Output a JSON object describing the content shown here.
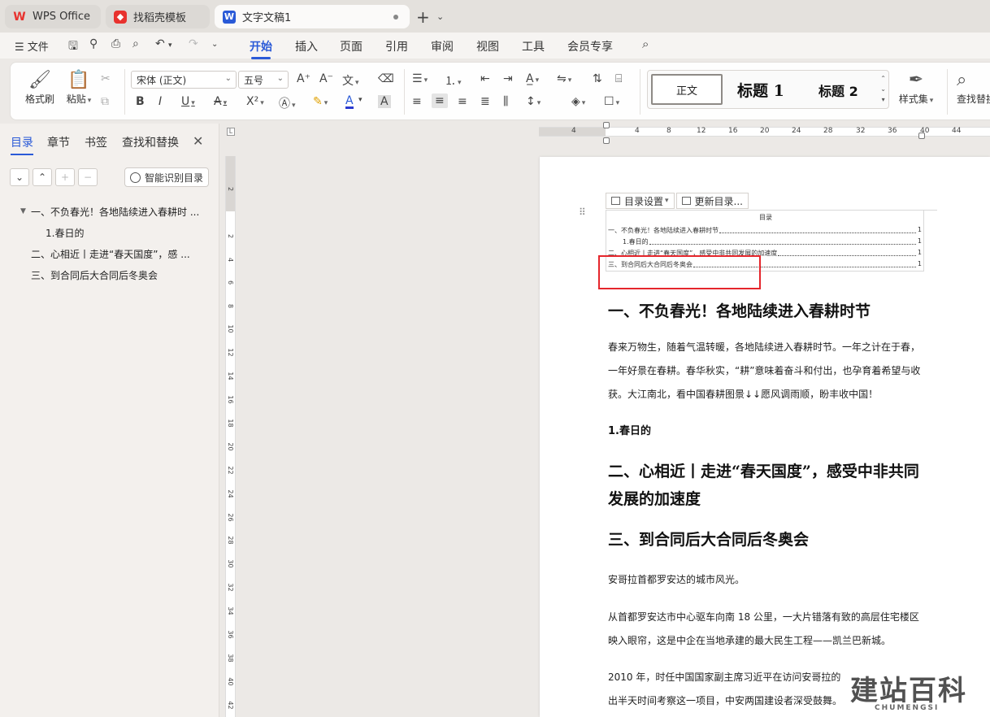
{
  "tabs": [
    {
      "label": "WPS Office",
      "logo": "W"
    },
    {
      "label": "找稻壳模板",
      "logo": "◆"
    },
    {
      "label": "文字文稿1",
      "logo": "W"
    }
  ],
  "menubar": {
    "file": "文件",
    "items": [
      "开始",
      "插入",
      "页面",
      "引用",
      "审阅",
      "视图",
      "工具",
      "会员专享"
    ],
    "active": "开始"
  },
  "ribbon": {
    "format_painter": "格式刷",
    "paste": "粘贴",
    "font_name": "宋体 (正文)",
    "font_size": "五号",
    "styles": {
      "normal": "正文",
      "heading1": "标题 1",
      "heading2": "标题 2"
    },
    "style_set": "样式集",
    "find_replace": "查找替换"
  },
  "nav": {
    "tabs": [
      "目录",
      "章节",
      "书签",
      "查找和替换"
    ],
    "smart_button": "智能识别目录",
    "toc": [
      {
        "label": "一、不负春光！各地陆续进入春耕时 ..."
      },
      {
        "label": "1.春日的"
      },
      {
        "label": "二、心相近丨走进“春天国度”，感 ..."
      },
      {
        "label": "三、到合同后大合同后冬奥会"
      }
    ]
  },
  "ruler": {
    "h_numbers": [
      "4",
      "4",
      "8",
      "12",
      "16",
      "20",
      "24",
      "28",
      "32",
      "36",
      "40",
      "44"
    ],
    "v_numbers": [
      "2",
      "2",
      "4",
      "6",
      "8",
      "10",
      "12",
      "14",
      "16",
      "18",
      "20",
      "22",
      "24",
      "26",
      "28",
      "30",
      "32",
      "34",
      "36",
      "38",
      "40",
      "42"
    ]
  },
  "document": {
    "toc_toolbar": {
      "settings": "目录设置",
      "update": "更新目录..."
    },
    "toc_title": "目录",
    "toc_lines": [
      {
        "text": "一、不负春光！各地陆续进入春耕时节",
        "page": "1"
      },
      {
        "text": "1.春日的",
        "page": "1"
      },
      {
        "text": "二、心相近丨走进“春天国度”，感受中非共同发展的加速度",
        "page": "1"
      },
      {
        "text": "三、到合同后大合同后冬奥会",
        "page": "1"
      }
    ],
    "heading1": "一、不负春光！各地陆续进入春耕时节",
    "para1": "春来万物生，随着气温转暖，各地陆续进入春耕时节。一年之计在于春，一年好景在春耕。春华秋实，“耕”意味着奋斗和付出，也孕育着希望与收获。大江南北，看中国春耕图景↓↓愿风调雨顺，盼丰收中国！",
    "subheading": "1.春日的",
    "heading2": "二、心相近丨走进“春天国度”，感受中非共同发展的加速度",
    "heading3": "三、到合同后大合同后冬奥会",
    "para2": "安哥拉首都罗安达的城市风光。",
    "para3": "从首都罗安达市中心驱车向南 18 公里，一大片错落有致的高层住宅楼区映入眼帘，这是中企在当地承建的最大民生工程——凯兰巴新城。",
    "para4": "2010 年，时任中国国家副主席习近平在访问安哥拉的",
    "para5": "出半天时间考察这一项目，中安两国建设者深受鼓舞。"
  },
  "watermark": {
    "big": "建站百科",
    "small": "CHUMENGSI"
  },
  "colors": {
    "accent": "#2a5ad7",
    "highlight": "#e5262c",
    "wps_red": "#e8322e"
  }
}
